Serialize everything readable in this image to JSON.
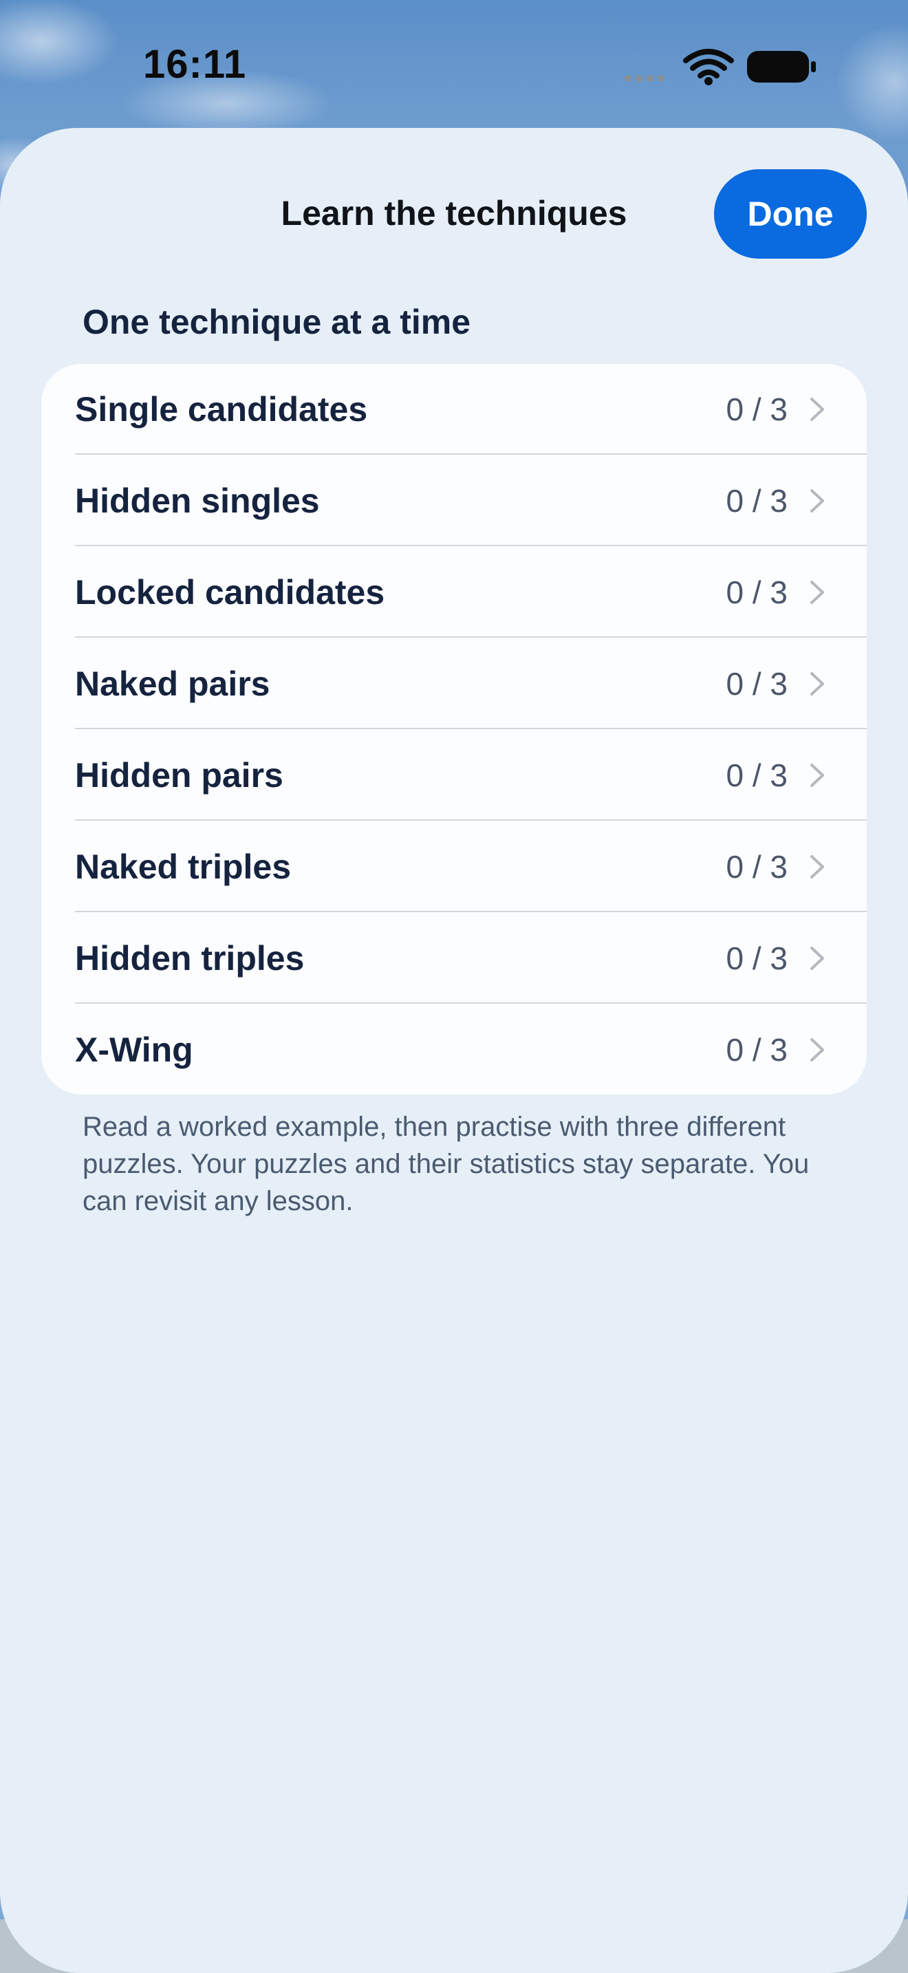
{
  "status_bar": {
    "time": "16:11",
    "icons": [
      "signal-dots-icon",
      "wifi-icon",
      "battery-icon"
    ]
  },
  "sheet": {
    "title": "Learn the techniques",
    "done_label": "Done",
    "section_header": "One technique at a time",
    "techniques": [
      {
        "label": "Single candidates",
        "progress": "0 / 3"
      },
      {
        "label": "Hidden singles",
        "progress": "0 / 3"
      },
      {
        "label": "Locked candidates",
        "progress": "0 / 3"
      },
      {
        "label": "Naked pairs",
        "progress": "0 / 3"
      },
      {
        "label": "Hidden pairs",
        "progress": "0 / 3"
      },
      {
        "label": "Naked triples",
        "progress": "0 / 3"
      },
      {
        "label": "Hidden triples",
        "progress": "0 / 3"
      },
      {
        "label": "X-Wing",
        "progress": "0 / 3"
      }
    ],
    "footer_note": "Read a worked example, then practise with three different puzzles. Your puzzles and their statistics stay separate. You can revisit any lesson."
  },
  "colors": {
    "accent": "#0a6ae0",
    "sheet_background": "#e6eff7",
    "card_background": "#fcfdfe",
    "primary_text": "#15233f",
    "secondary_text": "#4b5669"
  }
}
